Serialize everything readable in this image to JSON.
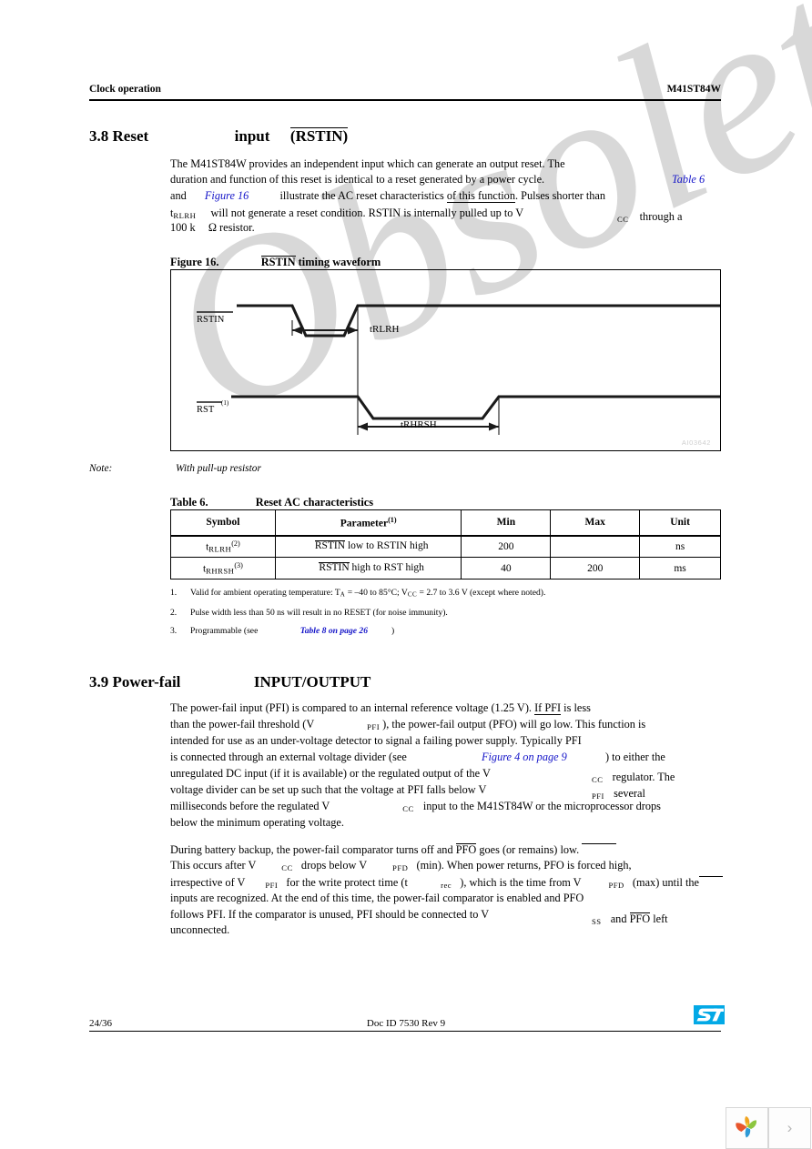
{
  "header": {
    "left": "Clock operation",
    "right": "M41ST84W"
  },
  "sections": [
    {
      "number": "3.8",
      "title_a": "Reset",
      "title_b": "input",
      "title_c": "(RSTIN)"
    },
    {
      "number": "3.9",
      "title_a": "Power-fail",
      "title_b": "INPUT/OUTPUT"
    }
  ],
  "body38": {
    "l1": "The M41ST84W provides an independent input which can generate an output reset. The",
    "l2": "duration and function of this reset is identical to a reset generated by a power cycle.",
    "l2_link": "Table 6",
    "l3_a": "and",
    "l3_link": "Figure 16",
    "l3_b": "illustrate the AC reset characteristics ",
    "l3_ovl": "of this function",
    "l3_c": ". Pulses shorter than",
    "l4_t": "t",
    "l4_sub": "RLRH",
    "l4_b": "will not generate a reset condition. RSTIN is internally pulled up to V",
    "l4_sub2": "CC",
    "l4_c": "through a",
    "l5_a": "100 k",
    "l5_omega": "Ω",
    "l5_b": "resistor."
  },
  "figure": {
    "label": "Figure 16.",
    "title_ovl": "RSTIN",
    "title_rest": "timing waveform",
    "id_mark": "AI03642",
    "signals": [
      {
        "name": "RSTIN",
        "overline": true,
        "footnote": ""
      },
      {
        "name": "RST",
        "overline": true,
        "footnote": "(1)"
      }
    ],
    "timings": [
      {
        "label": "tRLRH"
      },
      {
        "label": "tRHRSH"
      }
    ]
  },
  "note": {
    "label": "Note:",
    "text": "With pull-up resistor"
  },
  "table6": {
    "label": "Table 6.",
    "title": "Reset AC characteristics",
    "columns": [
      {
        "text": "Symbol",
        "sup": ""
      },
      {
        "text": "Parameter",
        "sup": "(1)"
      },
      {
        "text": "Min",
        "sup": ""
      },
      {
        "text": "Max",
        "sup": ""
      },
      {
        "text": "Unit",
        "sup": ""
      }
    ],
    "rows": [
      {
        "symbol_t": "t",
        "symbol_sub": "RLRH",
        "symbol_sup": "(2)",
        "param_a": "RSTIN",
        "param_b": " low to RSTIN",
        "param_c": " high",
        "min": "200",
        "max": "",
        "unit": "ns"
      },
      {
        "symbol_t": "t",
        "symbol_sub": "RHRSH",
        "symbol_sup": "(3)",
        "param_a": "RSTIN",
        "param_b": " high to RST",
        "param_c": " high",
        "min": "40",
        "max": "200",
        "unit": "ms"
      }
    ],
    "footnotes": [
      {
        "num": "1.",
        "a": "Valid for ambient operating temperature: T",
        "sub1": "A",
        "b": " = –40 to 85°C; V",
        "sub2": "CC",
        "c": " = 2.7 to 3.6 V (except where noted)."
      },
      {
        "num": "2.",
        "a": "Pulse width less than 50 ns will result in no RESET (for noise immunity).",
        "sub1": "",
        "b": "",
        "sub2": "",
        "c": ""
      },
      {
        "num": "3.",
        "a": "Programmable (see ",
        "link": "Table 8 on page 26",
        "c": ")",
        "sub1": "",
        "b": "",
        "sub2": ""
      }
    ]
  },
  "body39": {
    "l1": "The power-fail input (PFI) is compared to an internal reference voltage (1.25 V). ",
    "l1_ovl": "If PFI",
    "l1_b": " is less",
    "l2_a": "than the power-fail threshold (V",
    "l2_sub": "PFI",
    "l2_b": "), the power-fail output (PFO) will go low. This function is",
    "l3": "intended for use as an under-voltage detector to signal a failing power supply. Typically PFI",
    "l4_a": "is connected through an external voltage divider (see",
    "l4_link": "Figure 4 on page 9",
    "l4_b": ") to either the",
    "l5_a": "unregulated DC input (if it is available) or the regulated output of the V",
    "l5_sub": "CC",
    "l5_b": "regulator. The",
    "l6_a": "voltage divider can be set up such that the voltage at PFI falls below V",
    "l6_sub": "PFI",
    "l6_b": "several",
    "l7_a": "milliseconds before the regulated V",
    "l7_sub": "CC",
    "l7_b": "input to the M41ST84W or the microprocessor drops",
    "l8": "below the minimum operating voltage.",
    "p2_l1_a": "During battery backup, the power-fail comparator turns off and ",
    "p2_l1_ovl": "PFO",
    "p2_l1_b": " goes (or remains) low.",
    "p2_l2_a": "This occurs after V",
    "p2_l2_sub1": "CC",
    "p2_l2_b": "drops below V",
    "p2_l2_sub2": "PFD",
    "p2_l2_c": "(min). When power returns, PFO is forced high,",
    "p2_l3_a": "irrespective of V",
    "p2_l3_sub1": "PFI",
    "p2_l3_b": "for the write protect time (t",
    "p2_l3_sub2": "rec",
    "p2_l3_c": "), which is the time from V",
    "p2_l3_sub3": "PFD",
    "p2_l3_d": "(max) until the",
    "p2_l4": "inputs are recognized. At the end of this time, the power-fail comparator is enabled and PFO",
    "p2_l5_a": "follows PFI. If the comparator is unused, PFI should be connected to V",
    "p2_l5_sub": "SS",
    "p2_l5_b": "and ",
    "p2_l5_ovl": "PFO",
    "p2_l5_c": " left",
    "p2_l6": "unconnected."
  },
  "footer": {
    "page": "24/36",
    "doc": "Doc ID 7530 Rev 9",
    "logo_alt": "ST"
  },
  "watermark": {
    "text": "Obsolete P"
  },
  "nav": {
    "next_glyph": "›"
  },
  "colors": {
    "link": "#1414c8",
    "watermark": "#d8d8d8",
    "st_blue": "#03a9e6",
    "figure_id": "#cfcfcf"
  }
}
